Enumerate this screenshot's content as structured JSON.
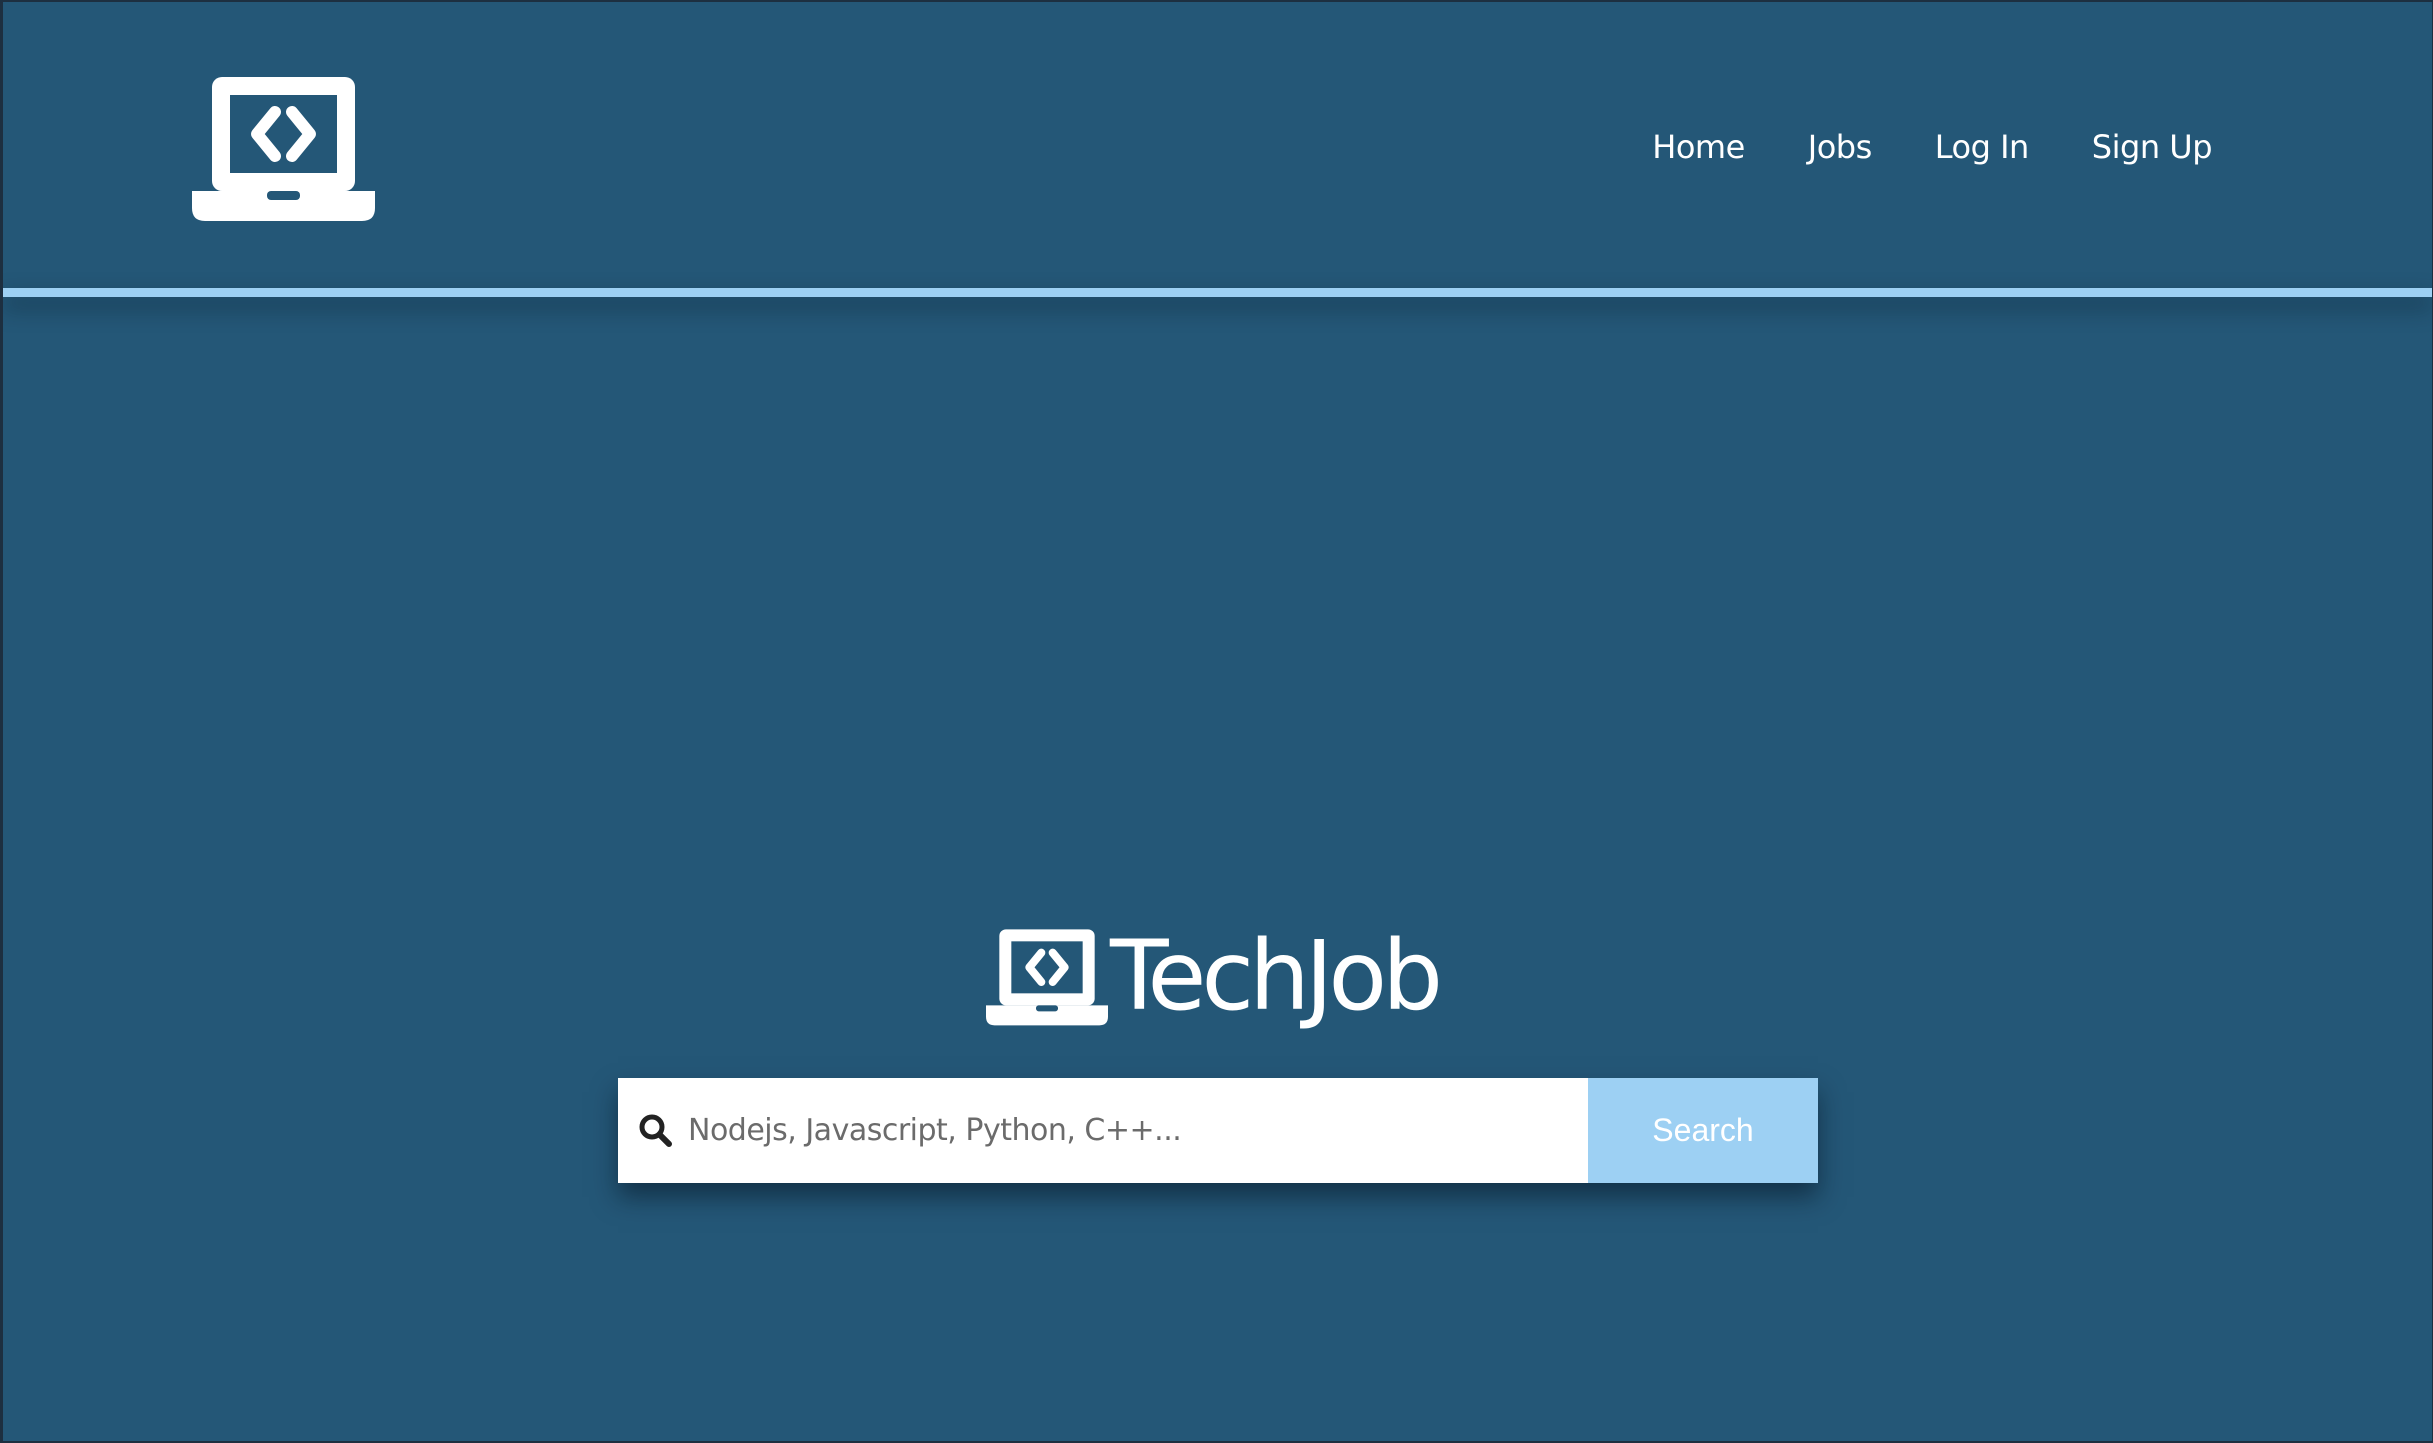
{
  "header": {
    "logo_icon": "laptop-code-icon",
    "nav": [
      {
        "label": "Home"
      },
      {
        "label": "Jobs"
      },
      {
        "label": "Log In"
      },
      {
        "label": "Sign Up"
      }
    ]
  },
  "hero": {
    "brand_icon": "laptop-code-icon",
    "brand_name": "TechJob"
  },
  "search": {
    "icon": "search-icon",
    "placeholder": "Nodejs, Javascript, Python, C++...",
    "button_label": "Search"
  },
  "colors": {
    "background": "#245777",
    "accent": "#9dd0f3",
    "text": "#ffffff"
  }
}
